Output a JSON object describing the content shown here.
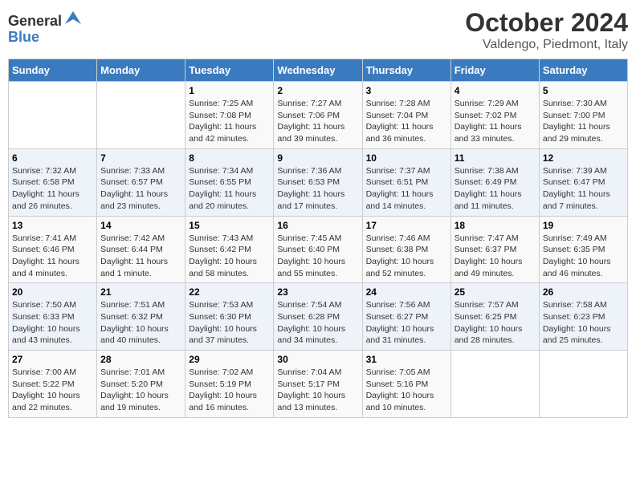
{
  "header": {
    "logo_line1": "General",
    "logo_line2": "Blue",
    "month": "October 2024",
    "location": "Valdengo, Piedmont, Italy"
  },
  "days_of_week": [
    "Sunday",
    "Monday",
    "Tuesday",
    "Wednesday",
    "Thursday",
    "Friday",
    "Saturday"
  ],
  "weeks": [
    [
      {
        "num": "",
        "info": ""
      },
      {
        "num": "",
        "info": ""
      },
      {
        "num": "1",
        "info": "Sunrise: 7:25 AM\nSunset: 7:08 PM\nDaylight: 11 hours and 42 minutes."
      },
      {
        "num": "2",
        "info": "Sunrise: 7:27 AM\nSunset: 7:06 PM\nDaylight: 11 hours and 39 minutes."
      },
      {
        "num": "3",
        "info": "Sunrise: 7:28 AM\nSunset: 7:04 PM\nDaylight: 11 hours and 36 minutes."
      },
      {
        "num": "4",
        "info": "Sunrise: 7:29 AM\nSunset: 7:02 PM\nDaylight: 11 hours and 33 minutes."
      },
      {
        "num": "5",
        "info": "Sunrise: 7:30 AM\nSunset: 7:00 PM\nDaylight: 11 hours and 29 minutes."
      }
    ],
    [
      {
        "num": "6",
        "info": "Sunrise: 7:32 AM\nSunset: 6:58 PM\nDaylight: 11 hours and 26 minutes."
      },
      {
        "num": "7",
        "info": "Sunrise: 7:33 AM\nSunset: 6:57 PM\nDaylight: 11 hours and 23 minutes."
      },
      {
        "num": "8",
        "info": "Sunrise: 7:34 AM\nSunset: 6:55 PM\nDaylight: 11 hours and 20 minutes."
      },
      {
        "num": "9",
        "info": "Sunrise: 7:36 AM\nSunset: 6:53 PM\nDaylight: 11 hours and 17 minutes."
      },
      {
        "num": "10",
        "info": "Sunrise: 7:37 AM\nSunset: 6:51 PM\nDaylight: 11 hours and 14 minutes."
      },
      {
        "num": "11",
        "info": "Sunrise: 7:38 AM\nSunset: 6:49 PM\nDaylight: 11 hours and 11 minutes."
      },
      {
        "num": "12",
        "info": "Sunrise: 7:39 AM\nSunset: 6:47 PM\nDaylight: 11 hours and 7 minutes."
      }
    ],
    [
      {
        "num": "13",
        "info": "Sunrise: 7:41 AM\nSunset: 6:46 PM\nDaylight: 11 hours and 4 minutes."
      },
      {
        "num": "14",
        "info": "Sunrise: 7:42 AM\nSunset: 6:44 PM\nDaylight: 11 hours and 1 minute."
      },
      {
        "num": "15",
        "info": "Sunrise: 7:43 AM\nSunset: 6:42 PM\nDaylight: 10 hours and 58 minutes."
      },
      {
        "num": "16",
        "info": "Sunrise: 7:45 AM\nSunset: 6:40 PM\nDaylight: 10 hours and 55 minutes."
      },
      {
        "num": "17",
        "info": "Sunrise: 7:46 AM\nSunset: 6:38 PM\nDaylight: 10 hours and 52 minutes."
      },
      {
        "num": "18",
        "info": "Sunrise: 7:47 AM\nSunset: 6:37 PM\nDaylight: 10 hours and 49 minutes."
      },
      {
        "num": "19",
        "info": "Sunrise: 7:49 AM\nSunset: 6:35 PM\nDaylight: 10 hours and 46 minutes."
      }
    ],
    [
      {
        "num": "20",
        "info": "Sunrise: 7:50 AM\nSunset: 6:33 PM\nDaylight: 10 hours and 43 minutes."
      },
      {
        "num": "21",
        "info": "Sunrise: 7:51 AM\nSunset: 6:32 PM\nDaylight: 10 hours and 40 minutes."
      },
      {
        "num": "22",
        "info": "Sunrise: 7:53 AM\nSunset: 6:30 PM\nDaylight: 10 hours and 37 minutes."
      },
      {
        "num": "23",
        "info": "Sunrise: 7:54 AM\nSunset: 6:28 PM\nDaylight: 10 hours and 34 minutes."
      },
      {
        "num": "24",
        "info": "Sunrise: 7:56 AM\nSunset: 6:27 PM\nDaylight: 10 hours and 31 minutes."
      },
      {
        "num": "25",
        "info": "Sunrise: 7:57 AM\nSunset: 6:25 PM\nDaylight: 10 hours and 28 minutes."
      },
      {
        "num": "26",
        "info": "Sunrise: 7:58 AM\nSunset: 6:23 PM\nDaylight: 10 hours and 25 minutes."
      }
    ],
    [
      {
        "num": "27",
        "info": "Sunrise: 7:00 AM\nSunset: 5:22 PM\nDaylight: 10 hours and 22 minutes."
      },
      {
        "num": "28",
        "info": "Sunrise: 7:01 AM\nSunset: 5:20 PM\nDaylight: 10 hours and 19 minutes."
      },
      {
        "num": "29",
        "info": "Sunrise: 7:02 AM\nSunset: 5:19 PM\nDaylight: 10 hours and 16 minutes."
      },
      {
        "num": "30",
        "info": "Sunrise: 7:04 AM\nSunset: 5:17 PM\nDaylight: 10 hours and 13 minutes."
      },
      {
        "num": "31",
        "info": "Sunrise: 7:05 AM\nSunset: 5:16 PM\nDaylight: 10 hours and 10 minutes."
      },
      {
        "num": "",
        "info": ""
      },
      {
        "num": "",
        "info": ""
      }
    ]
  ]
}
